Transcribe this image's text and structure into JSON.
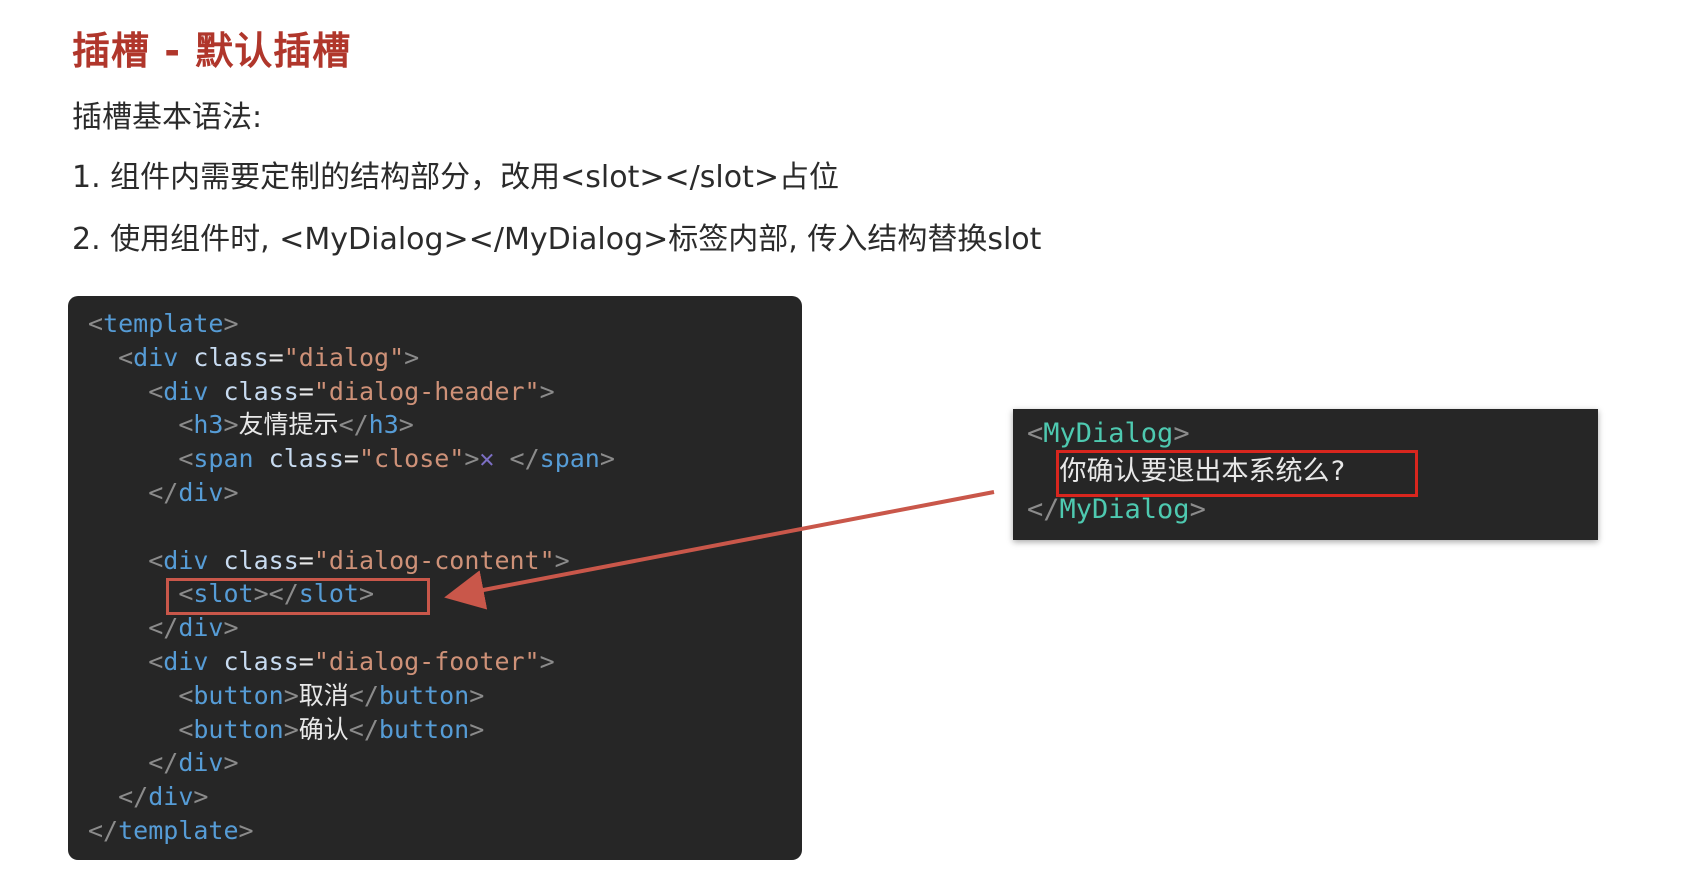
{
  "title": "插槽 - 默认插槽",
  "lines": {
    "l1": "插槽基本语法:",
    "l2": "1. 组件内需要定制的结构部分，改用<slot></slot>占位",
    "l3": "2. 使用组件时, <MyDialog></MyDialog>标签内部, 传入结构替换slot"
  },
  "code": {
    "tag_template": "template",
    "tag_div": "div",
    "tag_h3": "h3",
    "tag_span": "span",
    "tag_slot": "slot",
    "tag_button": "button",
    "attr_class": "class",
    "val_dialog": "\"dialog\"",
    "val_header": "\"dialog-header\"",
    "val_close": "\"close\"",
    "val_content": "\"dialog-content\"",
    "val_footer": "\"dialog-footer\"",
    "h3_text": "友情提示",
    "close_symbol": "✕",
    "btn_cancel": "取消",
    "btn_confirm": "确认"
  },
  "usage": {
    "tag": "MyDialog",
    "content": "你确认要退出本系统么?"
  },
  "colors": {
    "title": "#b0362b",
    "code_bg": "#262626",
    "highlight_red": "#d8261e",
    "arrow": "#c9574a"
  }
}
